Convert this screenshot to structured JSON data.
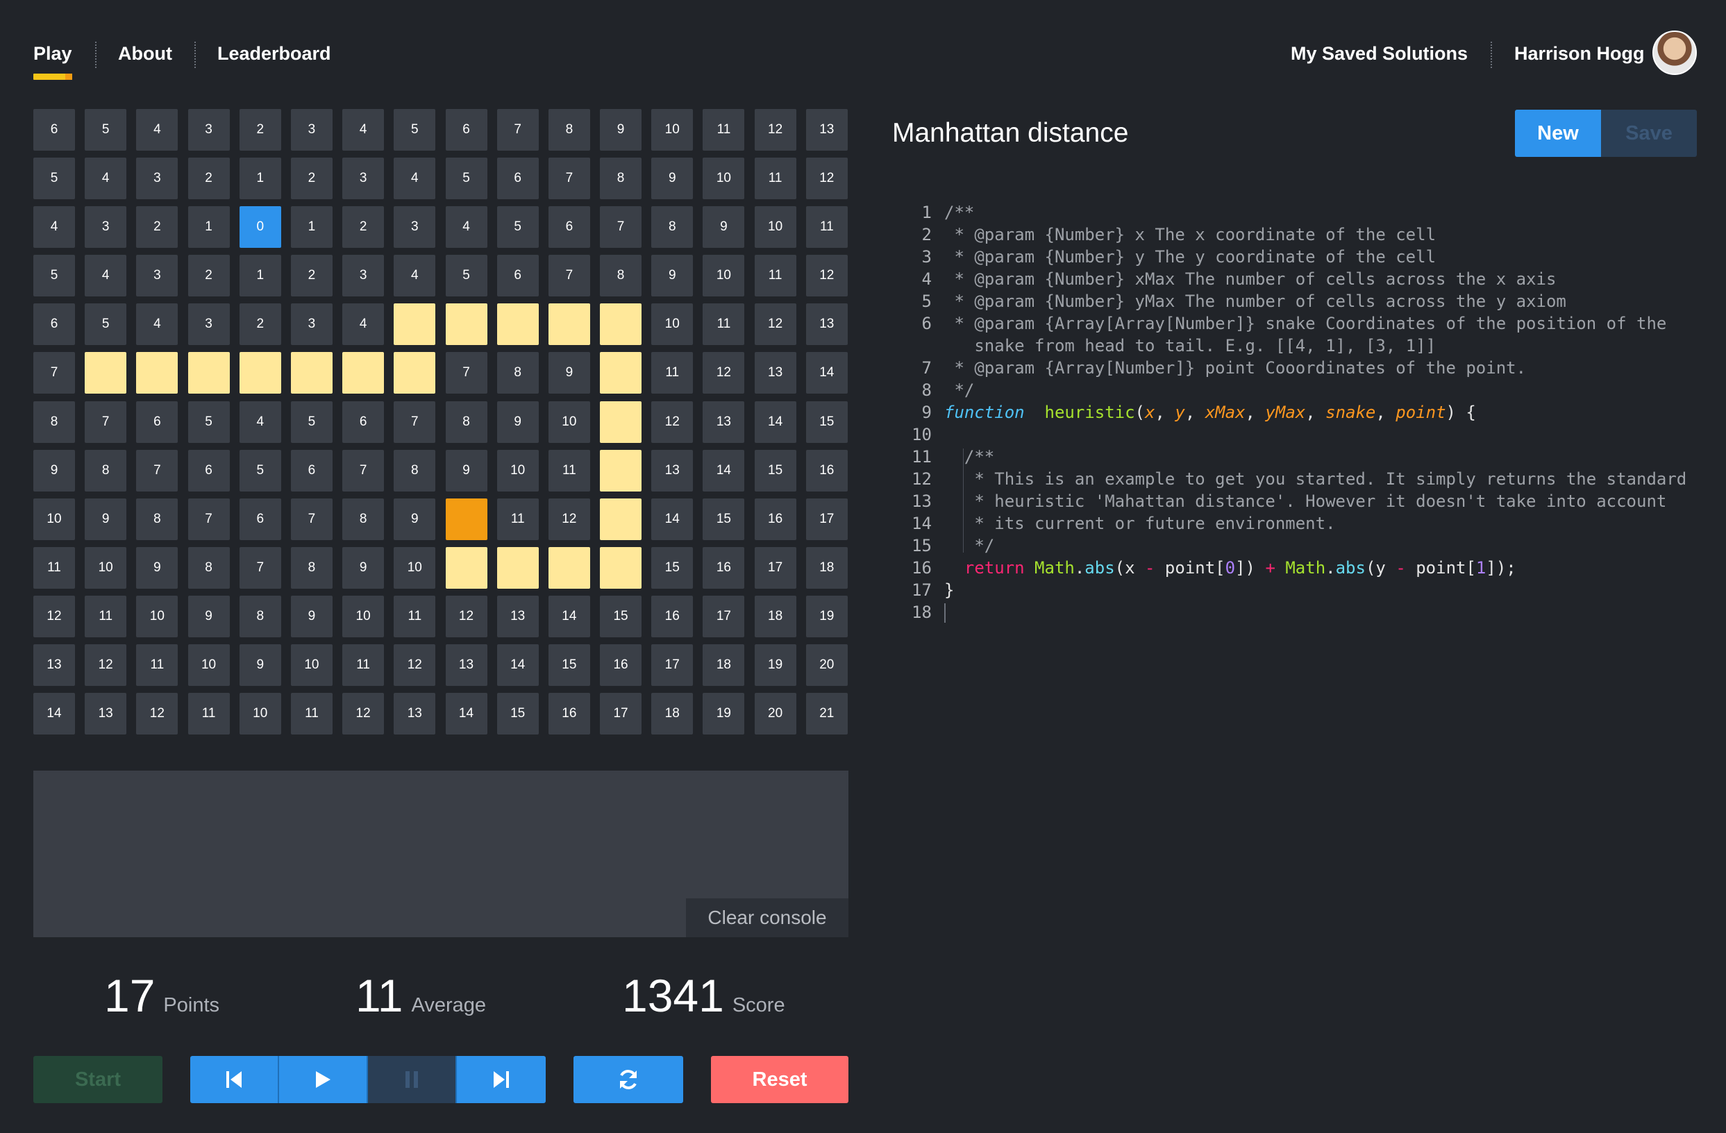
{
  "nav": {
    "left": [
      "Play",
      "About",
      "Leaderboard"
    ],
    "saved_solutions": "My Saved Solutions",
    "user_name": "Harrison Hogg"
  },
  "board": {
    "cols": 16,
    "rows": [
      [
        "6",
        "5",
        "4",
        "3",
        "2",
        "3",
        "4",
        "5",
        "6",
        "7",
        "8",
        "9",
        "10",
        "11",
        "12",
        "13"
      ],
      [
        "5",
        "4",
        "3",
        "2",
        "1",
        "2",
        "3",
        "4",
        "5",
        "6",
        "7",
        "8",
        "9",
        "10",
        "11",
        "12"
      ],
      [
        "4",
        "3",
        "2",
        "1",
        "0",
        "1",
        "2",
        "3",
        "4",
        "5",
        "6",
        "7",
        "8",
        "9",
        "10",
        "11"
      ],
      [
        "5",
        "4",
        "3",
        "2",
        "1",
        "2",
        "3",
        "4",
        "5",
        "6",
        "7",
        "8",
        "9",
        "10",
        "11",
        "12"
      ],
      [
        "6",
        "5",
        "4",
        "3",
        "2",
        "3",
        "4",
        "",
        "",
        "",
        "",
        "",
        "10",
        "11",
        "12",
        "13"
      ],
      [
        "7",
        "",
        "",
        "",
        "",
        "",
        "",
        "",
        "7",
        "8",
        "9",
        "",
        "11",
        "12",
        "13",
        "14"
      ],
      [
        "8",
        "7",
        "6",
        "5",
        "4",
        "5",
        "6",
        "7",
        "8",
        "9",
        "10",
        "",
        "12",
        "13",
        "14",
        "15"
      ],
      [
        "9",
        "8",
        "7",
        "6",
        "5",
        "6",
        "7",
        "8",
        "9",
        "10",
        "11",
        "",
        "13",
        "14",
        "15",
        "16"
      ],
      [
        "10",
        "9",
        "8",
        "7",
        "6",
        "7",
        "8",
        "9",
        "",
        "11",
        "12",
        "",
        "14",
        "15",
        "16",
        "17"
      ],
      [
        "11",
        "10",
        "9",
        "8",
        "7",
        "8",
        "9",
        "10",
        "",
        "",
        "",
        "",
        "15",
        "16",
        "17",
        "18"
      ],
      [
        "12",
        "11",
        "10",
        "9",
        "8",
        "9",
        "10",
        "11",
        "12",
        "13",
        "14",
        "15",
        "16",
        "17",
        "18",
        "19"
      ],
      [
        "13",
        "12",
        "11",
        "10",
        "9",
        "10",
        "11",
        "12",
        "13",
        "14",
        "15",
        "16",
        "17",
        "18",
        "19",
        "20"
      ],
      [
        "14",
        "13",
        "12",
        "11",
        "10",
        "11",
        "12",
        "13",
        "14",
        "15",
        "16",
        "17",
        "18",
        "19",
        "20",
        "21"
      ]
    ],
    "snake": [
      [
        7,
        4
      ],
      [
        8,
        4
      ],
      [
        9,
        4
      ],
      [
        10,
        4
      ],
      [
        11,
        4
      ],
      [
        1,
        5
      ],
      [
        2,
        5
      ],
      [
        3,
        5
      ],
      [
        4,
        5
      ],
      [
        5,
        5
      ],
      [
        6,
        5
      ],
      [
        7,
        5
      ],
      [
        11,
        5
      ],
      [
        11,
        6
      ],
      [
        11,
        7
      ],
      [
        11,
        8
      ],
      [
        8,
        9
      ],
      [
        9,
        9
      ],
      [
        10,
        9
      ],
      [
        11,
        9
      ]
    ],
    "head": [
      4,
      2
    ],
    "food": [
      8,
      8
    ],
    "colors": {
      "cell": "#3a3f47",
      "snake": "#ffe89a",
      "head": "#2e93ec",
      "food": "#f39c12"
    }
  },
  "console": {
    "clear_label": "Clear console"
  },
  "stats": {
    "points_value": "17",
    "points_label": "Points",
    "average_value": "11",
    "average_label": "Average",
    "score_value": "1341",
    "score_label": "Score"
  },
  "controls": {
    "start_label": "Start",
    "reset_label": "Reset",
    "icons": [
      "step-back-icon",
      "play-icon",
      "pause-icon",
      "step-forward-icon",
      "refresh-icon"
    ]
  },
  "editor": {
    "title": "Manhattan distance",
    "new_label": "New",
    "save_label": "Save",
    "lines": [
      [
        [
          "c-com",
          "/**"
        ]
      ],
      [
        [
          "c-com",
          " * @param {Number} x The x coordinate of the cell"
        ]
      ],
      [
        [
          "c-com",
          " * @param {Number} y The y coordinate of the cell"
        ]
      ],
      [
        [
          "c-com",
          " * @param {Number} xMax The number of cells across the x axis"
        ]
      ],
      [
        [
          "c-com",
          " * @param {Number} yMax The number of cells across the y axiom"
        ]
      ],
      [
        [
          "c-com",
          " * @param {Array[Array[Number]} snake Coordinates of the position of the"
        ]
      ],
      [
        [
          "c-com",
          "   snake from head to tail. E.g. [[4, 1], [3, 1]]"
        ]
      ],
      [
        [
          "c-com",
          " * @param {Array[Number]} point Cooordinates of the point."
        ]
      ],
      [
        [
          "c-com",
          " */"
        ]
      ],
      [
        [
          "c-kw",
          "function"
        ],
        [
          "",
          "  "
        ],
        [
          "c-fn",
          "heuristic"
        ],
        [
          "",
          "("
        ],
        [
          "c-par",
          "x"
        ],
        [
          "",
          ", "
        ],
        [
          "c-par",
          "y"
        ],
        [
          "",
          ", "
        ],
        [
          "c-par",
          "xMax"
        ],
        [
          "",
          ", "
        ],
        [
          "c-par",
          "yMax"
        ],
        [
          "",
          ", "
        ],
        [
          "c-par",
          "snake"
        ],
        [
          "",
          ", "
        ],
        [
          "c-par",
          "point"
        ],
        [
          "",
          ") {"
        ]
      ],
      [],
      [
        [
          "c-com",
          "  /**"
        ]
      ],
      [
        [
          "c-com",
          "   * This is an example to get you started. It simply returns the standard"
        ]
      ],
      [
        [
          "c-com",
          "   * heuristic 'Mahattan distance'. However it doesn't take into account"
        ]
      ],
      [
        [
          "c-com",
          "   * its current or future environment."
        ]
      ],
      [
        [
          "c-com",
          "   */"
        ]
      ],
      [
        [
          "c-ret",
          "  return "
        ],
        [
          "c-obj",
          "Math"
        ],
        [
          "",
          "."
        ],
        [
          "c-meth",
          "abs"
        ],
        [
          "",
          "(x "
        ],
        [
          "c-op",
          "-"
        ],
        [
          "",
          " point["
        ],
        [
          "c-num",
          "0"
        ],
        [
          "",
          "]) "
        ],
        [
          "c-op",
          "+"
        ],
        [
          "",
          " "
        ],
        [
          "c-obj",
          "Math"
        ],
        [
          "",
          "."
        ],
        [
          "c-meth",
          "abs"
        ],
        [
          "",
          "(y "
        ],
        [
          "c-op",
          "-"
        ],
        [
          "",
          " point["
        ],
        [
          "c-num",
          "1"
        ],
        [
          "",
          "]);"
        ]
      ],
      [
        [
          "",
          "}"
        ]
      ],
      []
    ],
    "line_numbers": [
      "1",
      "2",
      "3",
      "4",
      "5",
      "6",
      "",
      "7",
      "8",
      "9",
      "10",
      "11",
      "12",
      "13",
      "14",
      "15",
      "16",
      "17",
      "18"
    ]
  }
}
